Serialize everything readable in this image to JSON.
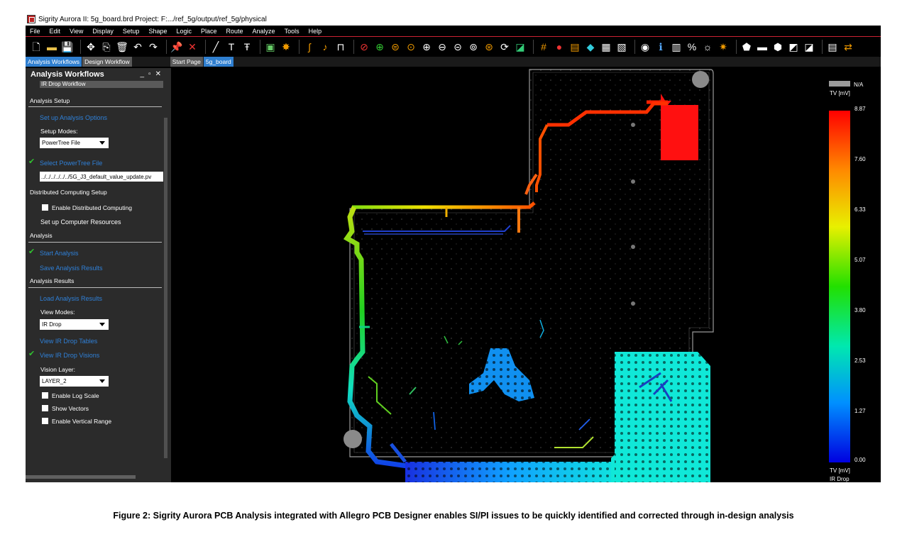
{
  "window": {
    "title": "Sigrity Aurora II: 5g_board.brd  Project: F:.../ref_5g/output/ref_5g/physical"
  },
  "menu": [
    "File",
    "Edit",
    "View",
    "Display",
    "Setup",
    "Shape",
    "Logic",
    "Place",
    "Route",
    "Analyze",
    "Tools",
    "Help"
  ],
  "tabs": {
    "left": [
      "Analysis Workflows",
      "Design Workflow"
    ],
    "right": [
      "Start Page",
      "5g_board"
    ]
  },
  "panel": {
    "title": "Analysis Workflows",
    "workflow": "IR Drop Workflow",
    "analysis_setup": "Analysis Setup",
    "setup_options_link": "Set up Analysis Options",
    "setup_modes_label": "Setup Modes:",
    "setup_modes_value": "PowerTree File",
    "select_powertree_link": "Select PowerTree File",
    "powertree_path": "../../../../../../5G_J3_default_value_update.pv",
    "distributed_setup": "Distributed Computing Setup",
    "enable_distributed": "Enable Distributed Computing",
    "computer_resources": "Set up Computer Resources",
    "analysis": "Analysis",
    "start_analysis_link": "Start Analysis",
    "save_results_link": "Save Analysis Results",
    "analysis_results": "Analysis Results",
    "load_results_link": "Load Analysis Results",
    "view_modes_label": "View Modes:",
    "view_modes_value": "IR Drop",
    "ir_drop_tables_link": "View IR Drop Tables",
    "ir_drop_visions_link": "View IR Drop Visions",
    "vision_layer_label": "Vision Layer:",
    "vision_layer_value": "LAYER_2",
    "enable_log_scale": "Enable Log Scale",
    "show_vectors": "Show Vectors",
    "enable_vertical_range": "Enable Vertical Range"
  },
  "legend": {
    "na_label": "N/A",
    "unit_top": "TV [mV]",
    "ticks": [
      "8.87",
      "7.60",
      "6.33",
      "5.07",
      "3.80",
      "2.53",
      "1.27",
      "0.00"
    ],
    "unit_bottom": "TV [mV]",
    "mode": "IR Drop"
  },
  "colors": {
    "link": "#2f80d8",
    "check": "#31c131",
    "tab_active": "#2f7fd0",
    "panel_bg": "#2b2b2b"
  },
  "caption": "Figure 2: Sigrity Aurora PCB Analysis integrated with Allegro PCB Designer enables SI/PI issues to be quickly identified and corrected through in-design analysis"
}
